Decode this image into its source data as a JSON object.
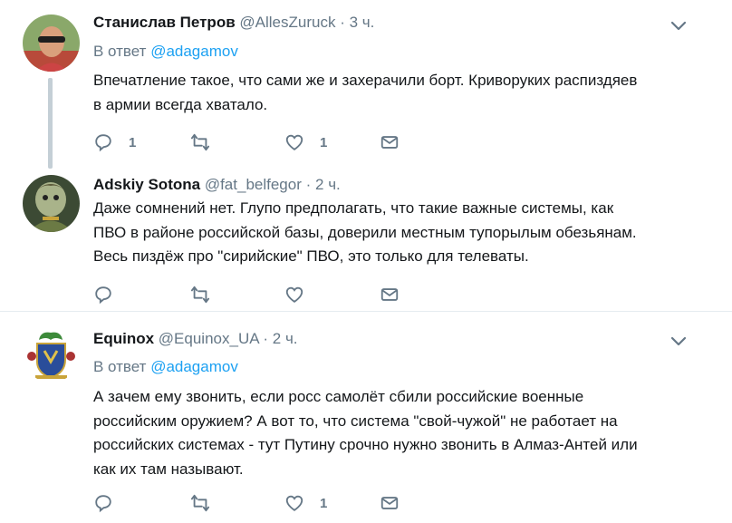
{
  "tweets": [
    {
      "name": "Станислав Петров",
      "handle": "@AllesZuruck",
      "sep": "·",
      "time": "3 ч.",
      "reply_prefix": "В ответ",
      "reply_to": "@adagamov",
      "lines": [
        "Впечатление такое, что сами же и захерачили борт. Криворуких распиздяев",
        "в армии всегда хватало."
      ],
      "reply_count": "1",
      "retweet_count": "",
      "like_count": "1"
    },
    {
      "name": "Adskiy Sotona",
      "handle": "@fat_belfegor",
      "sep": "·",
      "time": "2 ч.",
      "lines": [
        "Даже сомнений нет. Глупо предполагать, что такие важные системы, как",
        "ПВО в районе российской базы, доверили местным тупорылым обезьянам.",
        "Весь пиздёж про \"сирийские\" ПВО, это только для телеваты."
      ],
      "reply_count": "",
      "retweet_count": "",
      "like_count": ""
    },
    {
      "name": "Equinox",
      "handle": "@Equinox_UA",
      "sep": "·",
      "time": "2 ч.",
      "reply_prefix": "В ответ",
      "reply_to": "@adagamov",
      "lines": [
        "А зачем ему звонить, если росс самолёт сбили российские военные",
        "российским оружием? А вот то, что система \"свой-чужой\" не работает на",
        "российских системах - тут Путину срочно нужно звонить в Алмаз-Антей или",
        "как их там называют."
      ],
      "reply_count": "",
      "retweet_count": "",
      "like_count": "1"
    }
  ],
  "colors": {
    "link": "#1da1f2",
    "muted": "#657786",
    "text": "#14171a",
    "thread": "#c4cfd6"
  },
  "icons": [
    "reply-icon",
    "retweet-icon",
    "like-icon",
    "dm-icon",
    "caret-down-icon"
  ]
}
